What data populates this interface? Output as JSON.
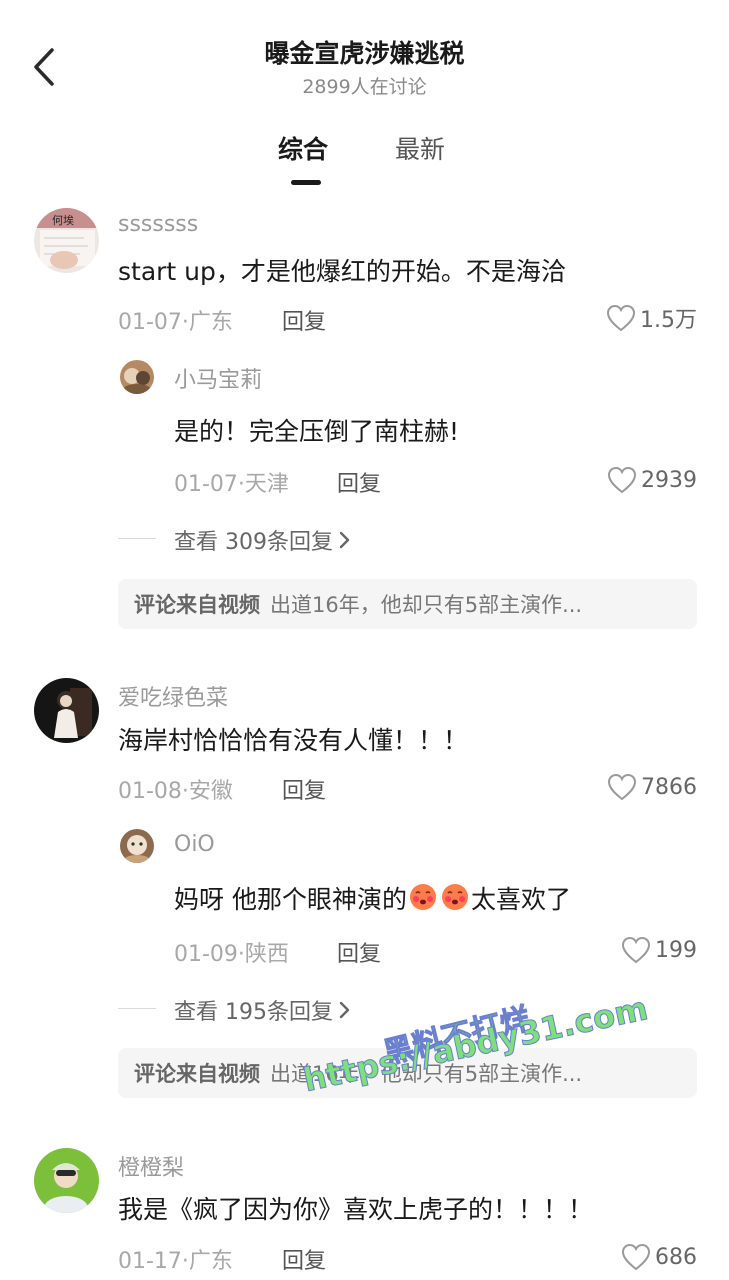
{
  "header": {
    "title": "曝金宣虎涉嫌逃税",
    "subtitle": "2899人在讨论",
    "tabs": [
      {
        "label": "综合",
        "active": true
      },
      {
        "label": "最新",
        "active": false
      }
    ]
  },
  "comments": [
    {
      "user": "sssssss",
      "avatar_caption": "何埃",
      "text": "start up，才是他爆红的开始。不是海洽",
      "date_loc": "01-07·广东",
      "reply_label": "回复",
      "likes": "1.5万",
      "sub_reply": {
        "user": "小马宝莉",
        "text": "是的！完全压倒了南柱赫!",
        "date_loc": "01-07·天津",
        "reply_label": "回复",
        "likes": "2939"
      },
      "more_replies": "查看 309条回复",
      "source_label": "评论来自视频",
      "source_text": "出道16年，他却只有5部主演作..."
    },
    {
      "user": "爱吃绿色菜",
      "text": "海岸村恰恰恰有没有人懂！！！",
      "date_loc": "01-08·安徽",
      "reply_label": "回复",
      "likes": "7866",
      "sub_reply": {
        "user": "OiO",
        "text_before": "妈呀 他那个眼神演的",
        "text_after": "太喜欢了",
        "date_loc": "01-09·陕西",
        "reply_label": "回复",
        "likes": "199"
      },
      "more_replies": "查看 195条回复",
      "source_label": "评论来自视频",
      "source_text": "出道16年，他却只有5部主演作..."
    },
    {
      "user": "橙橙梨",
      "text": "我是《疯了因为你》喜欢上虎子的！！！！",
      "date_loc": "01-17·广东",
      "reply_label": "回复",
      "likes": "686"
    }
  ],
  "watermark": {
    "line1": "黑料不打烊",
    "line2": "https://abdy31.com"
  },
  "colors": {
    "text": "#1a1a1a",
    "meta": "#a8a8a8",
    "source_bg": "#f5f5f5",
    "watermark": "#7ee07a"
  },
  "icons": [
    "chevron-left-icon",
    "heart-outline-icon",
    "chevron-right-icon",
    "blush-emoji-icon"
  ]
}
